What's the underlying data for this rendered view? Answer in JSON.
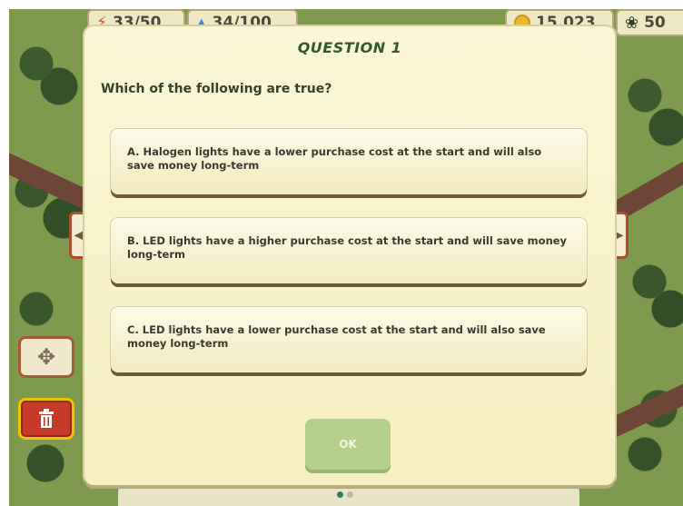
{
  "hud": {
    "energy_text": "33/50",
    "water_text": "34/100",
    "coins_text": "15,023",
    "leaf_text": "50"
  },
  "quiz": {
    "title": "QUESTION 1",
    "prompt": "Which of the following are true?",
    "answers": [
      {
        "text": "A. Halogen lights have a lower purchase cost at the start and will also save money long-term"
      },
      {
        "text": "B. LED lights have a higher purchase cost at the start and will save money long-term"
      },
      {
        "text": "C. LED lights have a lower purchase cost at the start and will also save money long-term"
      }
    ],
    "ok_label": "OK"
  },
  "icons": {
    "energy": "lightning-bolt",
    "water": "water-drop",
    "coins": "coin",
    "leaf": "leaf",
    "move": "move-arrows",
    "delete": "trash-can"
  },
  "pagination": {
    "current_page": 1,
    "total_pages": 2
  }
}
